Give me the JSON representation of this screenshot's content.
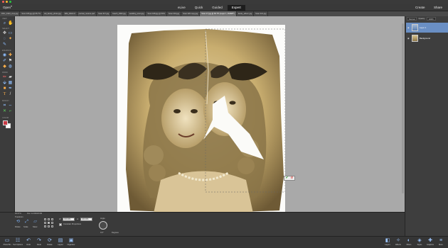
{
  "menu": {
    "open_label": "Open",
    "create_label": "Create",
    "share_label": "Share"
  },
  "modes": [
    {
      "label": "eLive",
      "active": false
    },
    {
      "label": "Quick",
      "active": false
    },
    {
      "label": "Guided",
      "active": false
    },
    {
      "label": "Expert",
      "active": true
    }
  ],
  "doc_tabs": [
    "DSC_0123_crop.jpg",
    "Scan 015.jpg @ 66.7%",
    "old_family_photo.jpg",
    "IMG_0042.tif",
    "portrait_restore.psd",
    "Scan 017.jpg",
    "beach_1962.jpg",
    "wedding_scan.jpg",
    "Scan 018.jpg @ 50%",
    "Scan 019.jpg",
    "Scan 020 copy.jpg",
    "Scan 17.jpg @ 66.7% (Layer 1, RGB/8*)",
    "family_album.jpg",
    "Scan 021.jpg"
  ],
  "active_tab_index": 11,
  "toolbox": {
    "sections": [
      "VIEW",
      "SELECT",
      "ENHANCE",
      "DRAW",
      "MODIFY",
      "COLOR"
    ],
    "foreground_color": "#c83a45",
    "background_color": "#ffffff"
  },
  "layers_panel": {
    "blend_mode": "Normal",
    "opacity_label": "Opacity:",
    "opacity_value": "100%",
    "layers": [
      {
        "name": "Layer 1",
        "selected": true
      },
      {
        "name": "Background",
        "selected": false
      }
    ]
  },
  "tool_options": {
    "status_zoom": "66.67%",
    "status_doc": "Doc: 12.0M/18.0M",
    "section_label": "Transform",
    "rotate_label": "Rotate",
    "scale_label": "Scale",
    "skew_label": "Skew",
    "w_label": "W:",
    "w_value": "100.00%",
    "h_label": "H:",
    "h_value": "100.00%",
    "constrain_label": "Constrain Proportions",
    "angle_label": "Angle",
    "angle_value": "0.0°",
    "degrees_label": "Degrees"
  },
  "bottom_left": [
    {
      "icon": "photo-bin-icon",
      "label": "Photo Bin"
    },
    {
      "icon": "tool-options-icon",
      "label": "Tool Options"
    },
    {
      "icon": "undo-icon",
      "label": "Undo"
    },
    {
      "icon": "redo-icon",
      "label": "Redo"
    },
    {
      "icon": "rotate-icon",
      "label": "Rotate"
    },
    {
      "icon": "layout-icon",
      "label": "Layout"
    },
    {
      "icon": "organizer-icon",
      "label": "Organizer"
    }
  ],
  "bottom_right": [
    {
      "icon": "layers-icon",
      "label": "Layers"
    },
    {
      "icon": "effects-icon",
      "label": "Effects"
    },
    {
      "icon": "filters-icon",
      "label": "Filters"
    },
    {
      "icon": "styles-icon",
      "label": "Styles"
    },
    {
      "icon": "graphics-icon",
      "label": "Graphics"
    },
    {
      "icon": "more-icon",
      "label": "More"
    }
  ],
  "commit_icon": "check-icon",
  "cancel_icon": "cancel-icon"
}
